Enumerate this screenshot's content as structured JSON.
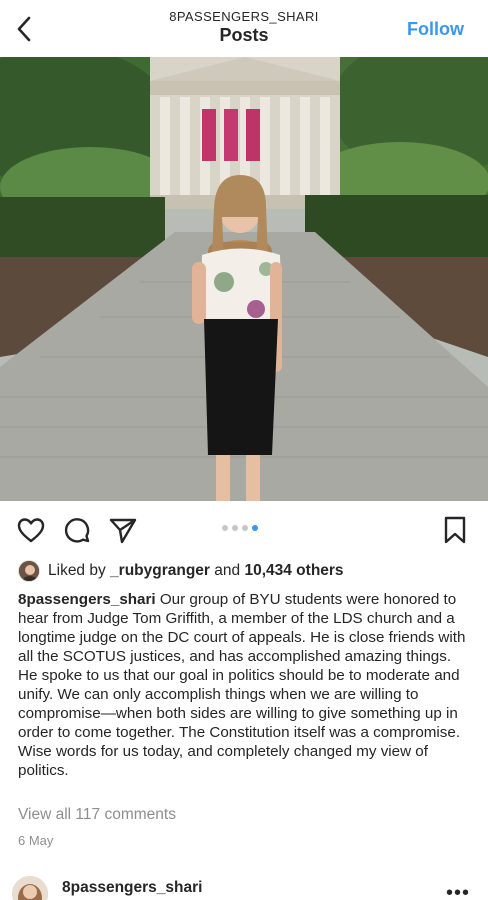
{
  "header": {
    "username": "8PASSENGERS_SHARI",
    "title": "Posts",
    "follow_label": "Follow",
    "back_icon": "chevron-left-icon"
  },
  "post": {
    "photo_alt": "",
    "carousel": {
      "total": 4,
      "active_index": 3
    },
    "likes": {
      "prefix": "Liked by",
      "user": "_rubygranger",
      "joiner": "and",
      "others": "10,434 others"
    },
    "caption": {
      "username": "8passengers_shari",
      "text": "Our group of BYU students were honored to hear from Judge Tom Griffith, a member of the LDS church and a longtime judge on the DC court of appeals. He is close friends with all the SCOTUS justices, and has accomplished amazing things. He spoke to us that our goal in politics should be to moderate and unify. We can only accomplish things when we are willing to compromise—when both sides are willing to give something up in order to come together. The Constitution itself was a compromise. Wise words for us today, and completely changed my view of politics."
    },
    "view_comments": "View all 117 comments",
    "date": "6 May"
  },
  "next_post": {
    "username": "8passengers_shari",
    "more_label": "•••"
  },
  "colors": {
    "accent": "#3897f0",
    "text": "#262626",
    "muted": "#8e8e8e"
  }
}
